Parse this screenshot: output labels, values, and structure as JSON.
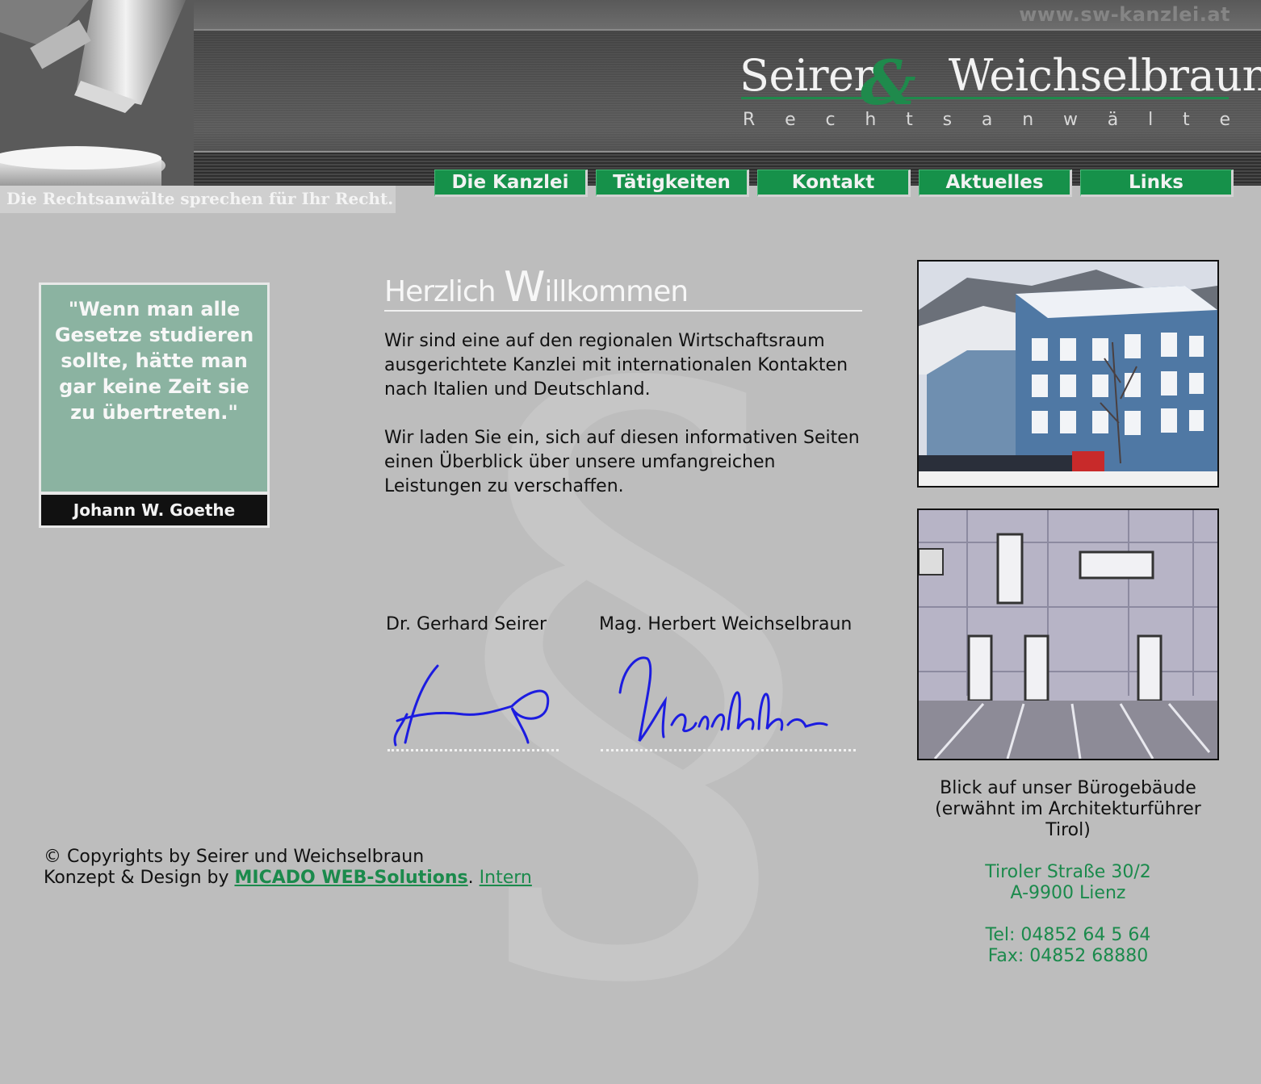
{
  "header": {
    "site_url": "www.sw-kanzlei.at",
    "logo_left": "Seirer",
    "logo_amp": "&",
    "logo_right": "Weichselbraun",
    "logo_sub_letters": [
      "R",
      "e",
      "c",
      "h",
      "t",
      "s",
      "a",
      "n",
      "w",
      "ä",
      "l",
      "t",
      "e"
    ],
    "slogan": "Die Rechtsanwälte sprechen für Ihr Recht."
  },
  "nav": {
    "items": [
      {
        "label": "Die Kanzlei"
      },
      {
        "label": "Tätigkeiten"
      },
      {
        "label": "Kontakt"
      },
      {
        "label": "Aktuelles"
      },
      {
        "label": "Links"
      }
    ]
  },
  "quote": {
    "text": "\"Wenn man alle Gesetze studieren sollte, hätte man gar keine Zeit sie zu übertreten.\"",
    "author": "Johann W. Goethe"
  },
  "welcome": {
    "title_part1": "Herzlich ",
    "title_big_letter": "W",
    "title_part2": "illkommen",
    "paragraph1": "Wir sind eine auf den regionalen Wirtschaftsraum ausgerichtete Kanzlei mit internationalen Kontakten nach Italien und Deutschland.",
    "paragraph2": "Wir laden Sie ein, sich auf diesen informativen Seiten einen Überblick über unsere umfangreichen Leistungen zu verschaffen."
  },
  "signers": [
    {
      "name": "Dr. Gerhard Seirer"
    },
    {
      "name": "Mag. Herbert Weichselbraun"
    }
  ],
  "sidebar": {
    "caption": "Blick auf unser Bürogebäude (erwähnt im Architekturführer Tirol)",
    "address_street": "Tiroler Straße 30/2",
    "address_city": "A-9900 Lienz",
    "tel": "Tel: 04852 64 5 64",
    "fax": "Fax: 04852 68880"
  },
  "footer": {
    "copyright": "© Copyrights by Seirer und Weichselbraun",
    "design_prefix": "Konzept & Design by ",
    "design_link": "MICADO WEB-Solutions",
    "separator": ".",
    "intern_link": "Intern"
  },
  "watermark": "§",
  "colors": {
    "brand_green": "#16914a",
    "background": "#bdbdbd",
    "quote_bg": "#8bb3a1",
    "signature_ink": "#1c1ce0"
  }
}
